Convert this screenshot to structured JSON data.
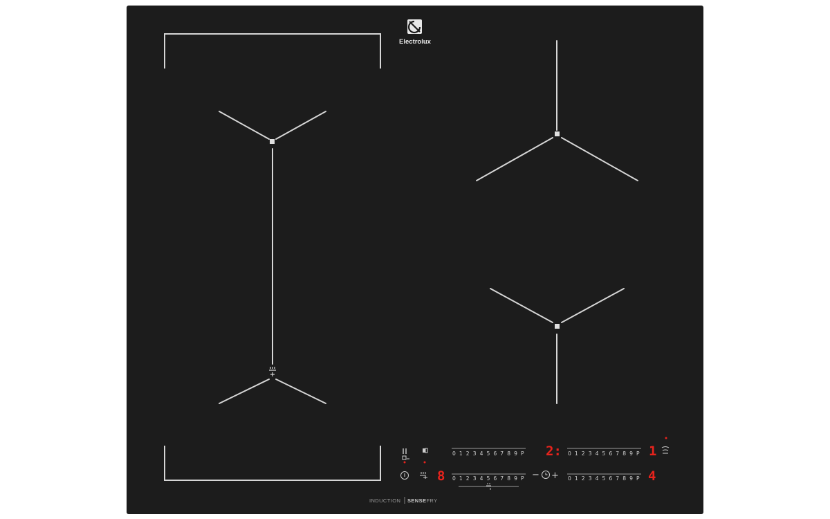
{
  "brand": {
    "name": "Electrolux"
  },
  "footer": {
    "left": "INDUCTION",
    "right_strong": "SENSE",
    "right_light": "FRY"
  },
  "controls": {
    "slider_scale": [
      "0",
      "1",
      "2",
      "3",
      "4",
      "5",
      "6",
      "7",
      "8",
      "9",
      "P"
    ],
    "displays": {
      "top_left_zone": "2:",
      "top_right_zone": "1",
      "bottom_left_zone": "8",
      "bottom_right_zone": "4"
    },
    "timer": {
      "minus_label": "−",
      "plus_label": "+"
    },
    "display_color": "#e8231c"
  },
  "colors": {
    "glass": "#1c1c1c",
    "marking": "#d6d6d6"
  }
}
